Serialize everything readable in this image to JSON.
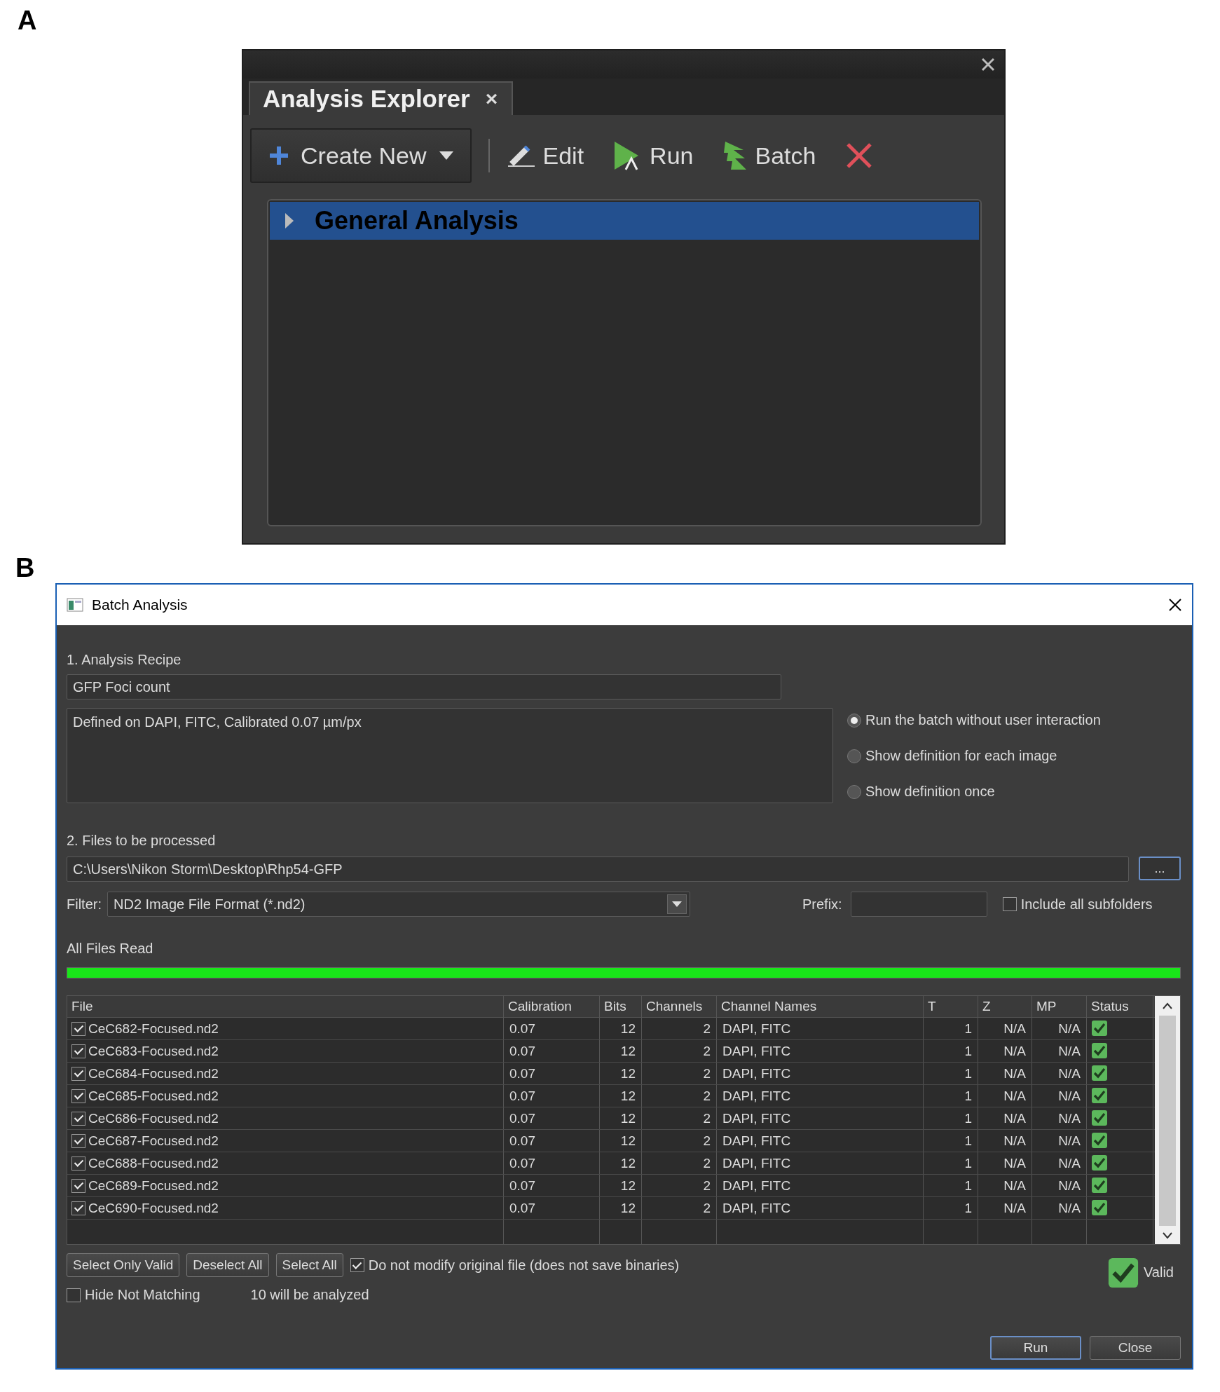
{
  "panel_a": {
    "label": "A",
    "tab": {
      "label": "Analysis Explorer",
      "close": "×"
    },
    "toolbar": [
      {
        "kind": "create",
        "label": "Create New"
      },
      {
        "kind": "edit",
        "label": "Edit"
      },
      {
        "kind": "run",
        "label": "Run"
      },
      {
        "kind": "batch",
        "label": "Batch"
      },
      {
        "kind": "delete"
      }
    ],
    "tree": [
      {
        "label": "General Analysis",
        "selected": true,
        "expanded": false
      }
    ]
  },
  "panel_b": {
    "label": "B",
    "title": "Batch Analysis",
    "recipe": {
      "heading": "1. Analysis Recipe",
      "name": "GFP Foci count",
      "description": "Defined on DAPI, FITC, Calibrated 0.07 µm/px"
    },
    "run_options": [
      {
        "label": "Run the batch without user interaction",
        "selected": true
      },
      {
        "label": "Show definition for each image",
        "selected": false
      },
      {
        "label": "Show definition once",
        "selected": false
      }
    ],
    "files": {
      "heading": "2. Files to be processed",
      "path": "C:\\Users\\Nikon Storm\\Desktop\\Rhp54-GFP",
      "browse": "...",
      "filter_label": "Filter:",
      "filter": "ND2 Image File Format (*.nd2)",
      "prefix_label": "Prefix:",
      "include_subfolders": {
        "label": "Include all subfolders",
        "checked": false
      }
    },
    "progress": {
      "label": "All Files Read",
      "level": 1
    },
    "table": {
      "columns": [
        "File",
        "Calibration",
        "Bits",
        "Channels",
        "Channel Names",
        "T",
        "Z",
        "MP",
        "Status"
      ],
      "rows": [
        {
          "checked": true,
          "cells": [
            "CeC682-Focused.nd2",
            "0.07",
            "12",
            "2",
            "DAPI, FITC",
            "1",
            "N/A",
            "N/A"
          ],
          "valid": true
        },
        {
          "checked": true,
          "cells": [
            "CeC683-Focused.nd2",
            "0.07",
            "12",
            "2",
            "DAPI, FITC",
            "1",
            "N/A",
            "N/A"
          ],
          "valid": true
        },
        {
          "checked": true,
          "cells": [
            "CeC684-Focused.nd2",
            "0.07",
            "12",
            "2",
            "DAPI, FITC",
            "1",
            "N/A",
            "N/A"
          ],
          "valid": true
        },
        {
          "checked": true,
          "cells": [
            "CeC685-Focused.nd2",
            "0.07",
            "12",
            "2",
            "DAPI, FITC",
            "1",
            "N/A",
            "N/A"
          ],
          "valid": true
        },
        {
          "checked": true,
          "cells": [
            "CeC686-Focused.nd2",
            "0.07",
            "12",
            "2",
            "DAPI, FITC",
            "1",
            "N/A",
            "N/A"
          ],
          "valid": true
        },
        {
          "checked": true,
          "cells": [
            "CeC687-Focused.nd2",
            "0.07",
            "12",
            "2",
            "DAPI, FITC",
            "1",
            "N/A",
            "N/A"
          ],
          "valid": true
        },
        {
          "checked": true,
          "cells": [
            "CeC688-Focused.nd2",
            "0.07",
            "12",
            "2",
            "DAPI, FITC",
            "1",
            "N/A",
            "N/A"
          ],
          "valid": true
        },
        {
          "checked": true,
          "cells": [
            "CeC689-Focused.nd2",
            "0.07",
            "12",
            "2",
            "DAPI, FITC",
            "1",
            "N/A",
            "N/A"
          ],
          "valid": true
        },
        {
          "checked": true,
          "cells": [
            "CeC690-Focused.nd2",
            "0.07",
            "12",
            "2",
            "DAPI, FITC",
            "1",
            "N/A",
            "N/A"
          ],
          "valid": true
        }
      ]
    },
    "selection_buttons": [
      "Select Only Valid",
      "Deselect All",
      "Select All"
    ],
    "do_not_modify": {
      "label": "Do not modify original file (does not save binaries)",
      "checked": true
    },
    "hide_not_matching": {
      "label": "Hide Not Matching",
      "checked": false
    },
    "count": "10 will be analyzed",
    "validity": {
      "label": "Valid",
      "valid": true
    },
    "dialog_buttons": [
      {
        "label": "Run",
        "default": true
      },
      {
        "label": "Close",
        "default": false
      }
    ]
  }
}
